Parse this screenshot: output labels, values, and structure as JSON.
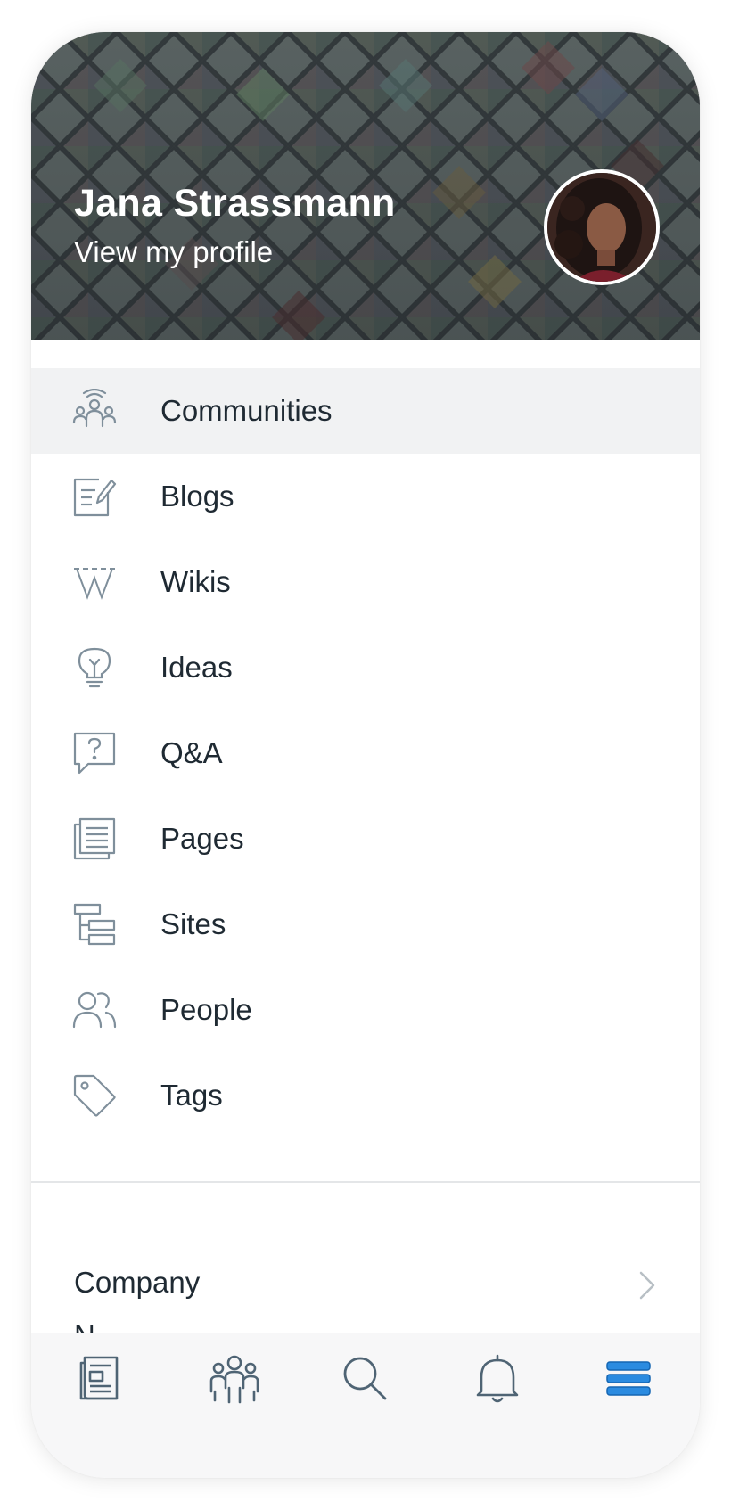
{
  "profile": {
    "name": "Jana Strassmann",
    "link_label": "View my profile"
  },
  "menu": {
    "items": [
      {
        "label": "Communities",
        "icon": "communities-icon",
        "active": true
      },
      {
        "label": "Blogs",
        "icon": "blogs-icon"
      },
      {
        "label": "Wikis",
        "icon": "wikis-icon"
      },
      {
        "label": "Ideas",
        "icon": "ideas-icon"
      },
      {
        "label": "Q&A",
        "icon": "qa-icon"
      },
      {
        "label": "Pages",
        "icon": "pages-icon"
      },
      {
        "label": "Sites",
        "icon": "sites-icon"
      },
      {
        "label": "People",
        "icon": "people-icon"
      },
      {
        "label": "Tags",
        "icon": "tags-icon"
      }
    ]
  },
  "section": {
    "company_label": "Company",
    "next_label_partial": "N"
  },
  "tabbar": {
    "tabs": [
      {
        "icon": "news-icon"
      },
      {
        "icon": "groups-icon"
      },
      {
        "icon": "search-icon"
      },
      {
        "icon": "bell-icon"
      },
      {
        "icon": "menu-icon",
        "active": true
      }
    ]
  },
  "colors": {
    "icon_gray": "#7f8f9b",
    "text_dark": "#1f2a33",
    "accent_blue": "#1e7fd6",
    "active_row": "#f1f2f3"
  }
}
